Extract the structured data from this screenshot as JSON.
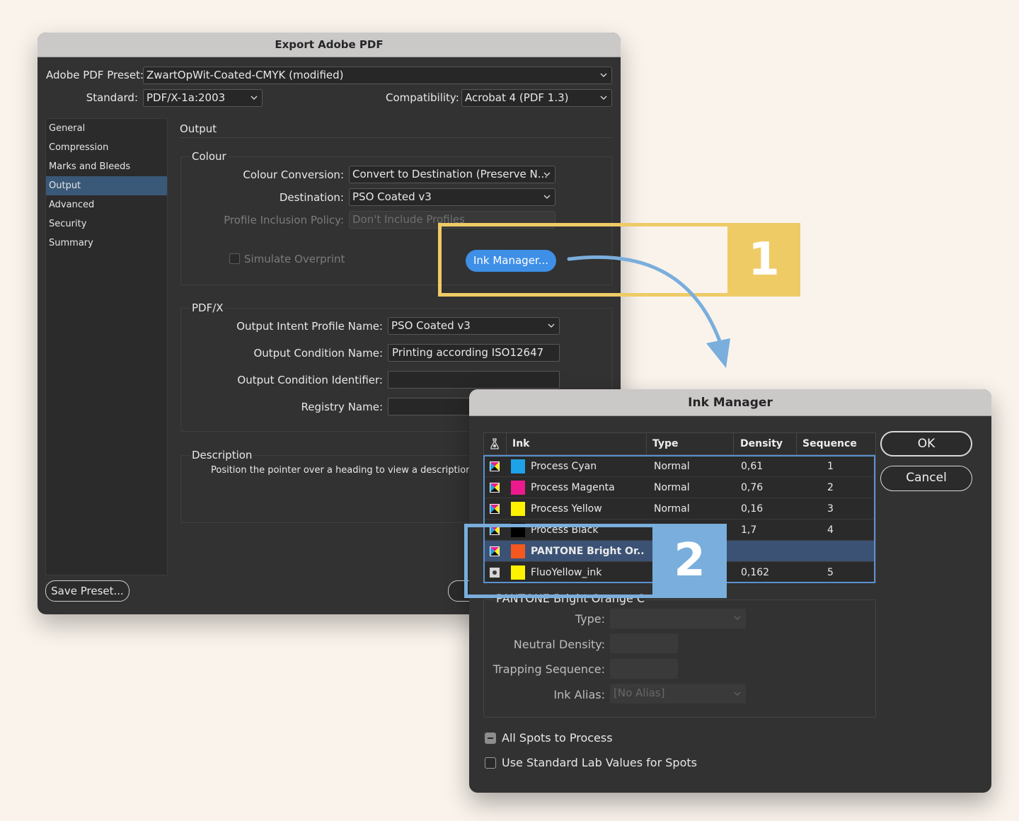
{
  "export_dialog": {
    "title": "Export Adobe PDF",
    "preset_label": "Adobe PDF Preset:",
    "preset_value": "ZwartOpWit-Coated-CMYK (modified)",
    "standard_label": "Standard:",
    "standard_value": "PDF/X-1a:2003",
    "compat_label": "Compatibility:",
    "compat_value": "Acrobat 4 (PDF 1.3)",
    "sidebar": [
      "General",
      "Compression",
      "Marks and Bleeds",
      "Output",
      "Advanced",
      "Security",
      "Summary"
    ],
    "sidebar_active": "Output",
    "section_title": "Output",
    "colour": {
      "title": "Colour",
      "conversion_label": "Colour Conversion:",
      "conversion_value": "Convert to Destination (Preserve N...",
      "destination_label": "Destination:",
      "destination_value": "PSO Coated v3",
      "profile_label": "Profile Inclusion Policy:",
      "profile_value": "Don't Include Profiles",
      "simulate_label": "Simulate Overprint",
      "ink_manager_button": "Ink Manager..."
    },
    "pdfx": {
      "title": "PDF/X",
      "intent_label": "Output Intent Profile Name:",
      "intent_value": "PSO Coated v3",
      "condition_label": "Output Condition Name:",
      "condition_value": "Printing according ISO12647",
      "identifier_label": "Output Condition Identifier:",
      "identifier_value": "",
      "registry_label": "Registry Name:",
      "registry_value": ""
    },
    "description": {
      "title": "Description",
      "text": "Position the pointer over a heading to view a description."
    },
    "save_preset_button": "Save Preset..."
  },
  "callouts": {
    "one": "1",
    "two": "2"
  },
  "ink_manager": {
    "title": "Ink Manager",
    "columns": {
      "ink": "Ink",
      "type": "Type",
      "density": "Density",
      "sequence": "Sequence"
    },
    "rows": [
      {
        "name": "Process Cyan",
        "type": "Normal",
        "density": "0,61",
        "sequence": "1",
        "color": "#1ea3e8",
        "icon": "process-ink"
      },
      {
        "name": "Process Magenta",
        "type": "Normal",
        "density": "0,76",
        "sequence": "2",
        "color": "#ec1a8c",
        "icon": "process-ink"
      },
      {
        "name": "Process Yellow",
        "type": "Normal",
        "density": "0,16",
        "sequence": "3",
        "color": "#fff200",
        "icon": "process-ink"
      },
      {
        "name": "Process Black",
        "type": "",
        "density": "1,7",
        "sequence": "4",
        "color": "#000000",
        "icon": "process-ink"
      },
      {
        "name": "PANTONE Bright Or...",
        "type": "",
        "density": "",
        "sequence": "",
        "color": "#f4581e",
        "icon": "process-ink",
        "selected": true
      },
      {
        "name": "FluoYellow_ink",
        "type": "",
        "density": "0,162",
        "sequence": "5",
        "color": "#fff200",
        "icon": "spot-ink"
      }
    ],
    "ok_button": "OK",
    "cancel_button": "Cancel",
    "detail": {
      "title": "PANTONE Bright Orange C",
      "type_label": "Type:",
      "neutral_label": "Neutral Density:",
      "trapping_label": "Trapping Sequence:",
      "alias_label": "Ink Alias:",
      "alias_value": "[No Alias]"
    },
    "all_spots_label": "All Spots to Process",
    "lab_values_label": "Use Standard Lab Values for Spots"
  }
}
